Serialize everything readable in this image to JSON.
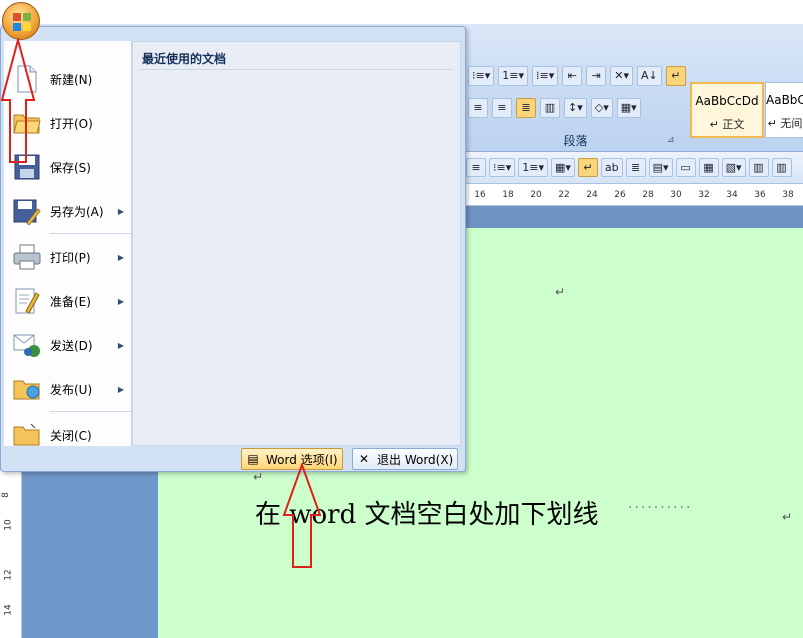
{
  "office_menu": {
    "recent_title": "最近使用的文档",
    "items": [
      {
        "label": "新建(N)",
        "icon": "new-document-icon",
        "has_submenu": false
      },
      {
        "label": "打开(O)",
        "icon": "open-folder-icon",
        "has_submenu": false
      },
      {
        "label": "保存(S)",
        "icon": "save-disk-icon",
        "has_submenu": false
      },
      {
        "label": "另存为(A)",
        "icon": "save-as-icon",
        "has_submenu": true
      },
      {
        "label": "打印(P)",
        "icon": "printer-icon",
        "has_submenu": true
      },
      {
        "label": "准备(E)",
        "icon": "prepare-document-icon",
        "has_submenu": true
      },
      {
        "label": "发送(D)",
        "icon": "send-icon",
        "has_submenu": true
      },
      {
        "label": "发布(U)",
        "icon": "publish-icon",
        "has_submenu": true
      },
      {
        "label": "关闭(C)",
        "icon": "close-folder-icon",
        "has_submenu": false
      }
    ],
    "word_options_label": "Word 选项(I)",
    "exit_label": "退出 Word(X)"
  },
  "ribbon": {
    "paragraph_group_label": "段落",
    "styles": [
      {
        "sample": "AaBbCcDd",
        "name": "↵ 正文",
        "selected": true
      },
      {
        "sample": "AaBbC",
        "name": "↵ 无间",
        "selected": false
      }
    ]
  },
  "ruler": {
    "numbers": [
      "16",
      "18",
      "20",
      "22",
      "24",
      "26",
      "28",
      "30",
      "32",
      "34",
      "36",
      "38"
    ],
    "vertical_numbers": [
      "8",
      "10",
      "12",
      "14"
    ]
  },
  "document": {
    "text": "在 word 文档空白处加下划线",
    "dots": "··········",
    "paragraph_mark": "↵",
    "page_color": "#ccffcc"
  },
  "colors": {
    "annotation_arrow": "#e0201c",
    "highlight": "#f8d57a"
  }
}
